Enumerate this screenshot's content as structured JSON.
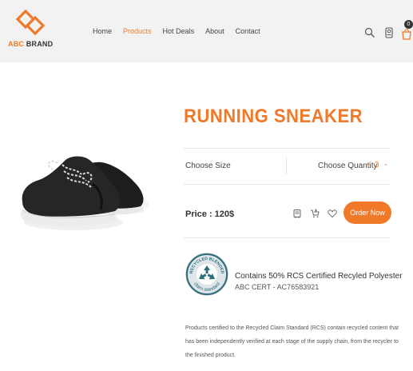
{
  "brand": {
    "abc": "ABC",
    "brand": " BRAND",
    "accent": "#f07a2a"
  },
  "nav": [
    {
      "label": "Home",
      "active": false
    },
    {
      "label": "Products",
      "active": true
    },
    {
      "label": "Hot Deals",
      "active": false
    },
    {
      "label": "About",
      "active": false
    },
    {
      "label": "Contact",
      "active": false
    }
  ],
  "header_icons": [
    "search-icon",
    "user-icon",
    "shopping-bag-icon"
  ],
  "cart": {
    "count": "0"
  },
  "product": {
    "image": "black-running-sneaker-photo",
    "title": "RUNNING SNEAKER",
    "choose_size_label": "Choose Size",
    "choose_quantity_label": "Choose Quantity",
    "quantity_plus": "+",
    "quantity": "3",
    "quantity_minus": "-",
    "price": "Price : 120$",
    "action_icons": [
      "delivery-icon",
      "add-to-cart-icon",
      "heart-icon"
    ],
    "order_button": "Order Now"
  },
  "certification": {
    "badge_icon": "recycled-blended-claim-standard-badge",
    "badge_text_top": "RECYCLED BLENDED",
    "badge_text_bottom": "claim standard",
    "title": "Contains 50% RCS Certified Recyled Polyester",
    "cert": "ABC CERT - AC76583921",
    "description": "Products certified to the Recycled Claim Standard (RCS) contain recycled content that has been independently verified at each stage of the supply chain, from the recycler to the finished product."
  }
}
